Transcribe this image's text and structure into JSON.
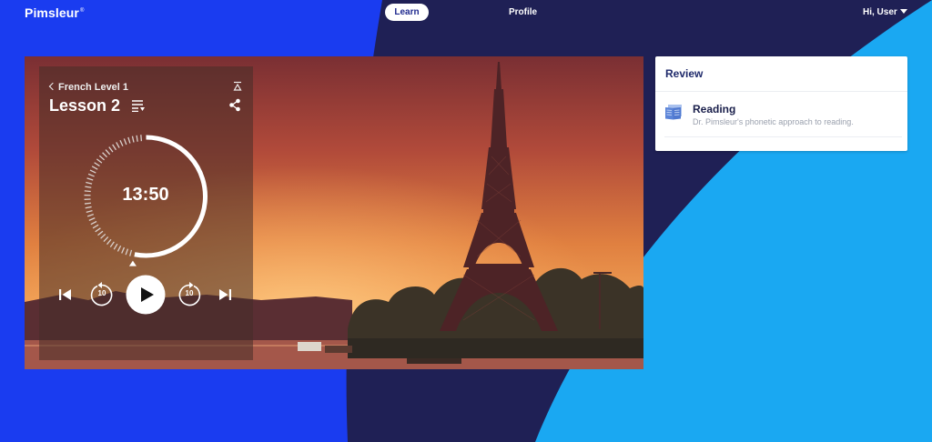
{
  "brand": {
    "name": "Pimsleur",
    "mark": "®"
  },
  "nav": {
    "learn": "Learn",
    "profile": "Profile",
    "user_greeting": "Hi, User"
  },
  "player": {
    "course": "French Level 1",
    "lesson": "Lesson 2",
    "time_remaining": "13:50",
    "progress_fraction": 0.42,
    "skip_back_seconds": "10",
    "skip_forward_seconds": "10",
    "icons": [
      "chevron-left-icon",
      "collapse-icon",
      "playlist-icon",
      "share-icon",
      "skip-previous-icon",
      "rewind-10-icon",
      "play-icon",
      "forward-10-icon",
      "skip-next-icon"
    ]
  },
  "review": {
    "title": "Review",
    "items": [
      {
        "title": "Reading",
        "description": "Dr. Pimsleur's phonetic approach to reading.",
        "icon": "book-icon"
      }
    ]
  },
  "colors": {
    "royal_blue": "#1a3cf0",
    "navy": "#1f2055",
    "sky_blue": "#1aa8f2",
    "white": "#ffffff"
  }
}
